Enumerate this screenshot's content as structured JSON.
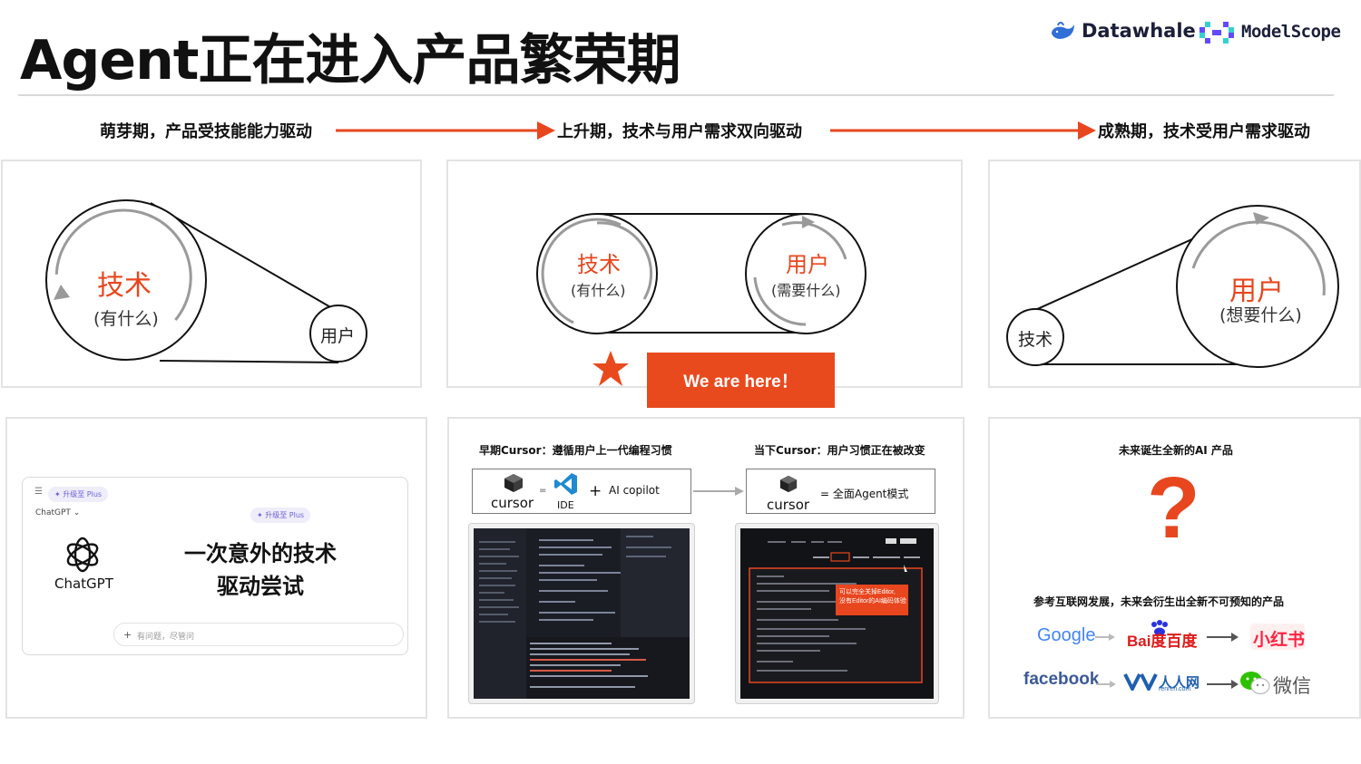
{
  "title": "Agent正在进入产品繁荣期",
  "logos": {
    "datawhale": "Datawhale",
    "modelscope": "ModelScope"
  },
  "stages": [
    "萌芽期，产品受技能能力驱动",
    "上升期，技术与用户需求双向驱动",
    "成熟期，技术受用户需求驱动"
  ],
  "panel1": {
    "big": "技术",
    "big_sub": "(有什么)",
    "small": "用户"
  },
  "panel2": {
    "left": "技术",
    "left_sub": "(有什么)",
    "right": "用户",
    "right_sub": "(需要什么)"
  },
  "panel3": {
    "small": "技术",
    "big": "用户",
    "big_sub": "(想要什么)"
  },
  "we_are_here": "We are here！",
  "chatgpt_card": {
    "pill_top": "✦ 升级至 Plus",
    "pill_mid": "✦ 升级至 Plus",
    "menu": "ChatGPT ⌄",
    "logo_text": "ChatGPT",
    "headline_1": "一次意外的技术",
    "headline_2": "驱动尝试",
    "input_placeholder": "有问题，尽管问"
  },
  "cursor_section": {
    "early_caption": "早期Cursor：遵循用户上一代编程习惯",
    "now_caption": "当下Cursor：用户习惯正在被改变",
    "cursor_word": "cursor",
    "equals": "=",
    "ide": "IDE",
    "plus": "+",
    "ai_copilot": "AI copilot",
    "agent_mode": "= 全面Agent模式",
    "callout": "可以完全关掉Editor,\n没有Editor的AI编码体验"
  },
  "future_section": {
    "caption": "未来诞生全新的AI 产品",
    "question": "?",
    "note": "参考互联网发展，未来会衍生出全新不可预知的产品",
    "row1": [
      "Google",
      "Bai度百度",
      "小红书"
    ],
    "row2": [
      "facebook",
      "人人网",
      "微信"
    ],
    "renren_sub": "renren.com"
  },
  "colors": {
    "accent": "#e84a1e",
    "facebook": "#3b5998",
    "xhs": "#ff2442",
    "wechat": "#2dc100"
  }
}
